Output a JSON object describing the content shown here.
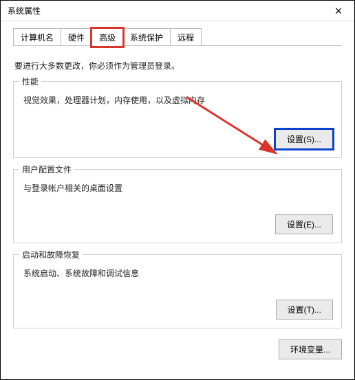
{
  "titlebar": {
    "title": "系统属性"
  },
  "tabs": {
    "computer_name": "计算机名",
    "hardware": "硬件",
    "advanced": "高级",
    "system_protection": "系统保护",
    "remote": "远程"
  },
  "description": "要进行大多数更改，你必须作为管理员登录。",
  "groups": {
    "performance": {
      "legend": "性能",
      "text": "视觉效果，处理器计划，内存使用，以及虚拟内存",
      "button": "设置(S)..."
    },
    "user_profiles": {
      "legend": "用户配置文件",
      "text": "与登录帐户相关的桌面设置",
      "button": "设置(E)..."
    },
    "startup_recovery": {
      "legend": "启动和故障恢复",
      "text": "系统启动、系统故障和调试信息",
      "button": "设置(T)..."
    }
  },
  "footer": {
    "env_vars": "环境变量..."
  }
}
